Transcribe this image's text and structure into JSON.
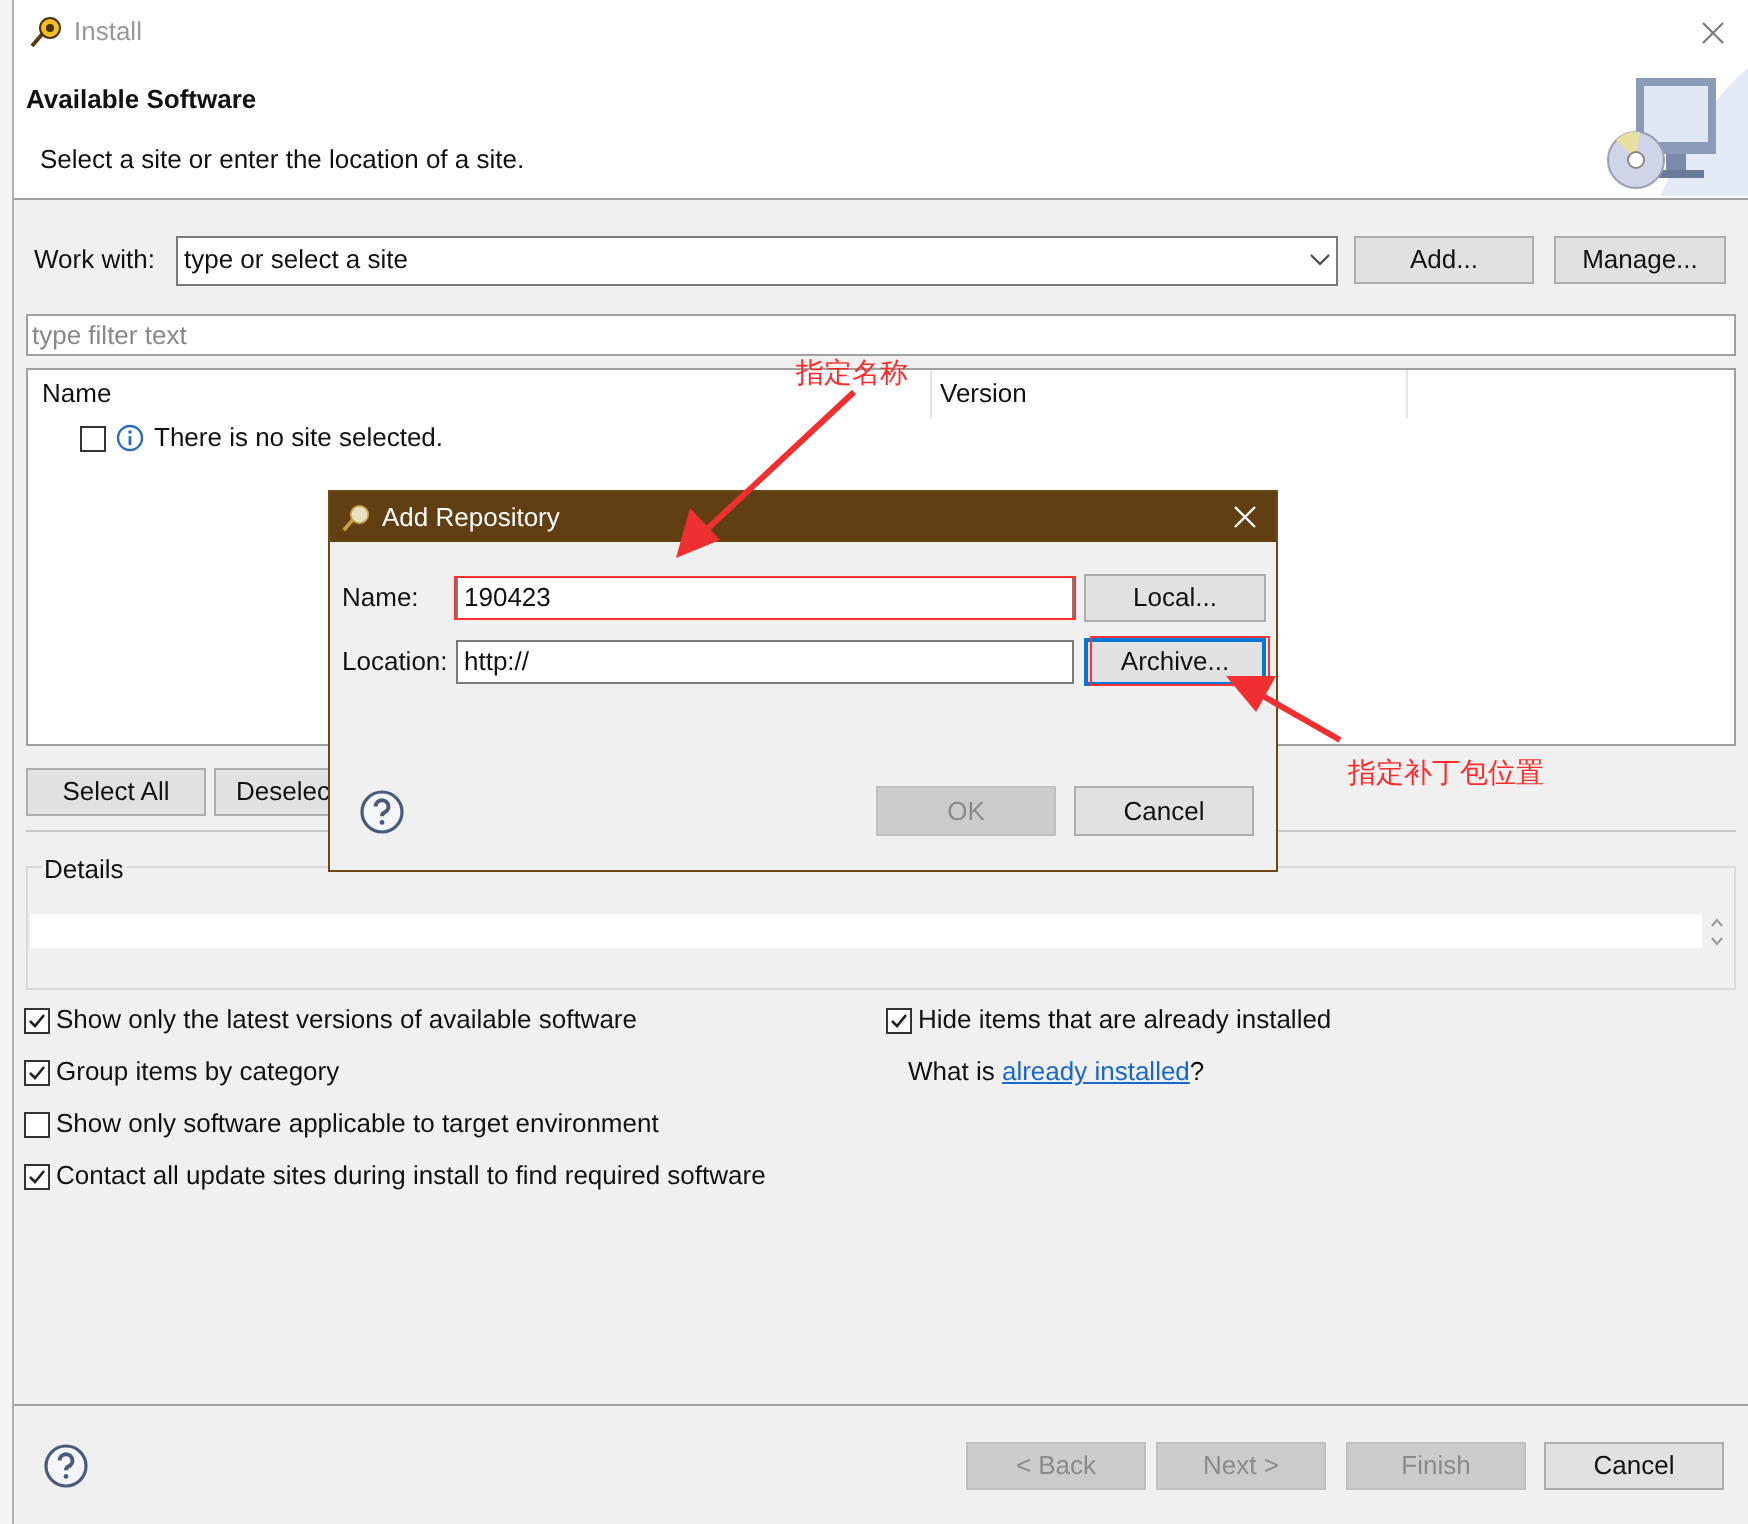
{
  "window": {
    "title": "Install"
  },
  "header": {
    "title": "Available Software",
    "subtitle": "Select a site or enter the location of a site."
  },
  "work_with": {
    "label": "Work with:",
    "value": "type or select a site",
    "buttons": [
      {
        "label": "Add..."
      },
      {
        "label": "Manage..."
      }
    ]
  },
  "filter": {
    "placeholder": "type filter text"
  },
  "table": {
    "columns": [
      "Name",
      "Version"
    ],
    "rows": [
      {
        "checked": false,
        "text": "There is no site selected."
      }
    ]
  },
  "selection_buttons": [
    {
      "label": "Select All"
    },
    {
      "label": "Deselec"
    }
  ],
  "details": {
    "label": "Details"
  },
  "options": [
    {
      "label": "Show only the latest versions of available software",
      "checked": true
    },
    {
      "label": "Group items by category",
      "checked": true
    },
    {
      "label": "Show only software applicable to target environment",
      "checked": false
    },
    {
      "label": "Contact all update sites during install to find required software",
      "checked": true
    }
  ],
  "side_options": [
    {
      "label": "Hide items that are already installed",
      "checked": true
    }
  ],
  "installed_note": {
    "prefix": "What is ",
    "link": "already installed",
    "suffix": "?"
  },
  "footer_buttons": [
    {
      "label": "< Back",
      "disabled": true
    },
    {
      "label": "Next >",
      "disabled": true
    },
    {
      "label": "Finish",
      "disabled": true
    },
    {
      "label": "Cancel",
      "disabled": false
    }
  ],
  "dialog": {
    "title": "Add Repository",
    "fields": [
      {
        "label": "Name:",
        "value": "190423",
        "button": "Local...",
        "focused": false
      },
      {
        "label": "Location:",
        "value": "http://",
        "button": "Archive...",
        "focused": true
      }
    ],
    "buttons": [
      {
        "label": "OK",
        "disabled": true
      },
      {
        "label": "Cancel",
        "disabled": false
      }
    ]
  },
  "annotations": [
    {
      "text": "指定名称"
    },
    {
      "text": "指定补丁包位置"
    }
  ]
}
